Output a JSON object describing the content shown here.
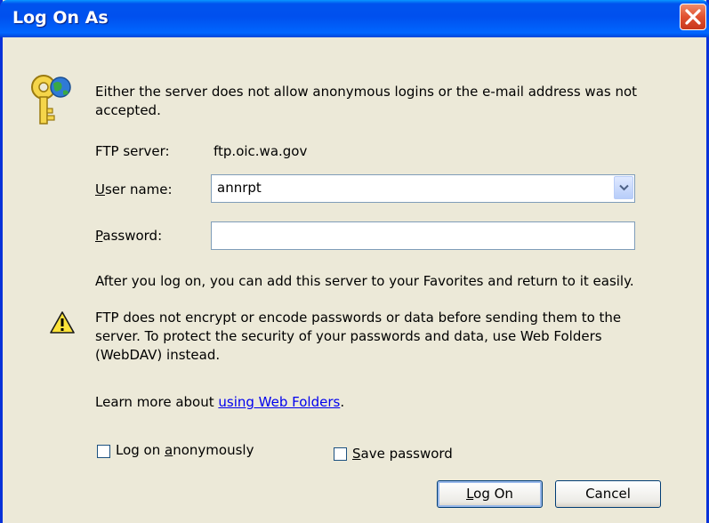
{
  "dialog": {
    "title": "Log On As"
  },
  "message": "Either the server does not allow anonymous logins or the e-mail address was not accepted.",
  "ftp_server": {
    "label": "FTP server:",
    "value": "ftp.oic.wa.gov"
  },
  "username": {
    "label_mnemonic": "U",
    "label_rest": "ser name:",
    "value": "annrpt"
  },
  "password": {
    "label_mnemonic": "P",
    "label_rest": "assword:",
    "value": ""
  },
  "info_text": "After you log on, you can add this server to your Favorites and return to it easily.",
  "warning_text": "FTP does not encrypt or encode passwords or data before sending them to the server.  To protect the security of your passwords and data, use Web Folders (WebDAV) instead.",
  "learn_more": {
    "prefix": "Learn more about ",
    "link": "using Web Folders",
    "suffix": "."
  },
  "checkboxes": {
    "anonymous": {
      "label_pre": "Log on ",
      "mnemonic": "a",
      "label_post": "nonymously",
      "checked": false
    },
    "save_password": {
      "mnemonic": "S",
      "label_post": "ave password",
      "checked": false
    }
  },
  "buttons": {
    "logon": {
      "mnemonic": "L",
      "rest": "og On"
    },
    "cancel": "Cancel"
  }
}
